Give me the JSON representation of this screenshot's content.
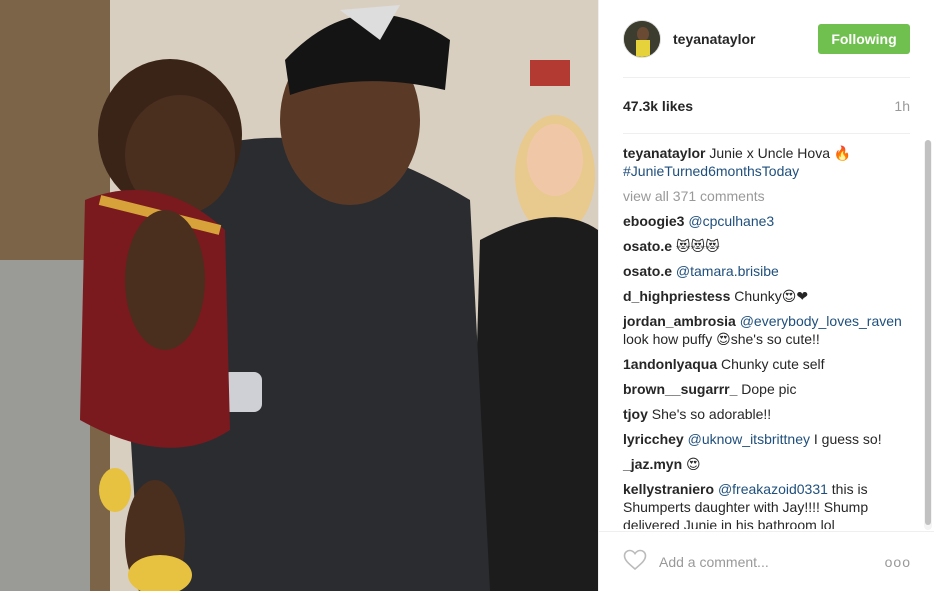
{
  "header": {
    "username": "teyanataylor",
    "follow_label": "Following",
    "follow_color": "#70c050"
  },
  "stats": {
    "likes": "47.3k likes",
    "time": "1h"
  },
  "caption": {
    "user": "teyanataylor",
    "text": "Junie x Uncle Hova 🔥",
    "hashtag": "#JunieTurned6monthsToday"
  },
  "view_all": "view all 371 comments",
  "comments": [
    {
      "user": "eboogie3",
      "mention": "@cpculhane3",
      "text": ""
    },
    {
      "user": "osato.e",
      "mention": "",
      "text": "😻😻😻"
    },
    {
      "user": "osato.e",
      "mention": "@tamara.brisibe",
      "text": ""
    },
    {
      "user": "d_highpriestess",
      "mention": "",
      "text": "Chunky😍❤"
    },
    {
      "user": "jordan_ambrosia",
      "mention": "@everybody_loves_raven",
      "text": " look how puffy 😍she's so cute!!"
    },
    {
      "user": "1andonlyaqua",
      "mention": "",
      "text": "Chunky cute self"
    },
    {
      "user": "brown__sugarrr_",
      "mention": "",
      "text": "Dope pic"
    },
    {
      "user": "tjoy",
      "mention": "",
      "text": "She's so adorable!!"
    },
    {
      "user": "lyricchey",
      "mention": "@uknow_itsbrittney",
      "text": " I guess so!"
    },
    {
      "user": "_jaz.myn",
      "mention": "",
      "text": "😍"
    },
    {
      "user": "kellystraniero",
      "mention": "@freakazoid0331",
      "text": " this is Shumperts daughter with Jay!!!! Shump delivered Junie in his bathroom lol"
    }
  ],
  "add_comment": {
    "placeholder": "Add a comment...",
    "more": "ooo"
  },
  "icons": {
    "heart": "heart-icon",
    "more": "more-options-icon"
  }
}
